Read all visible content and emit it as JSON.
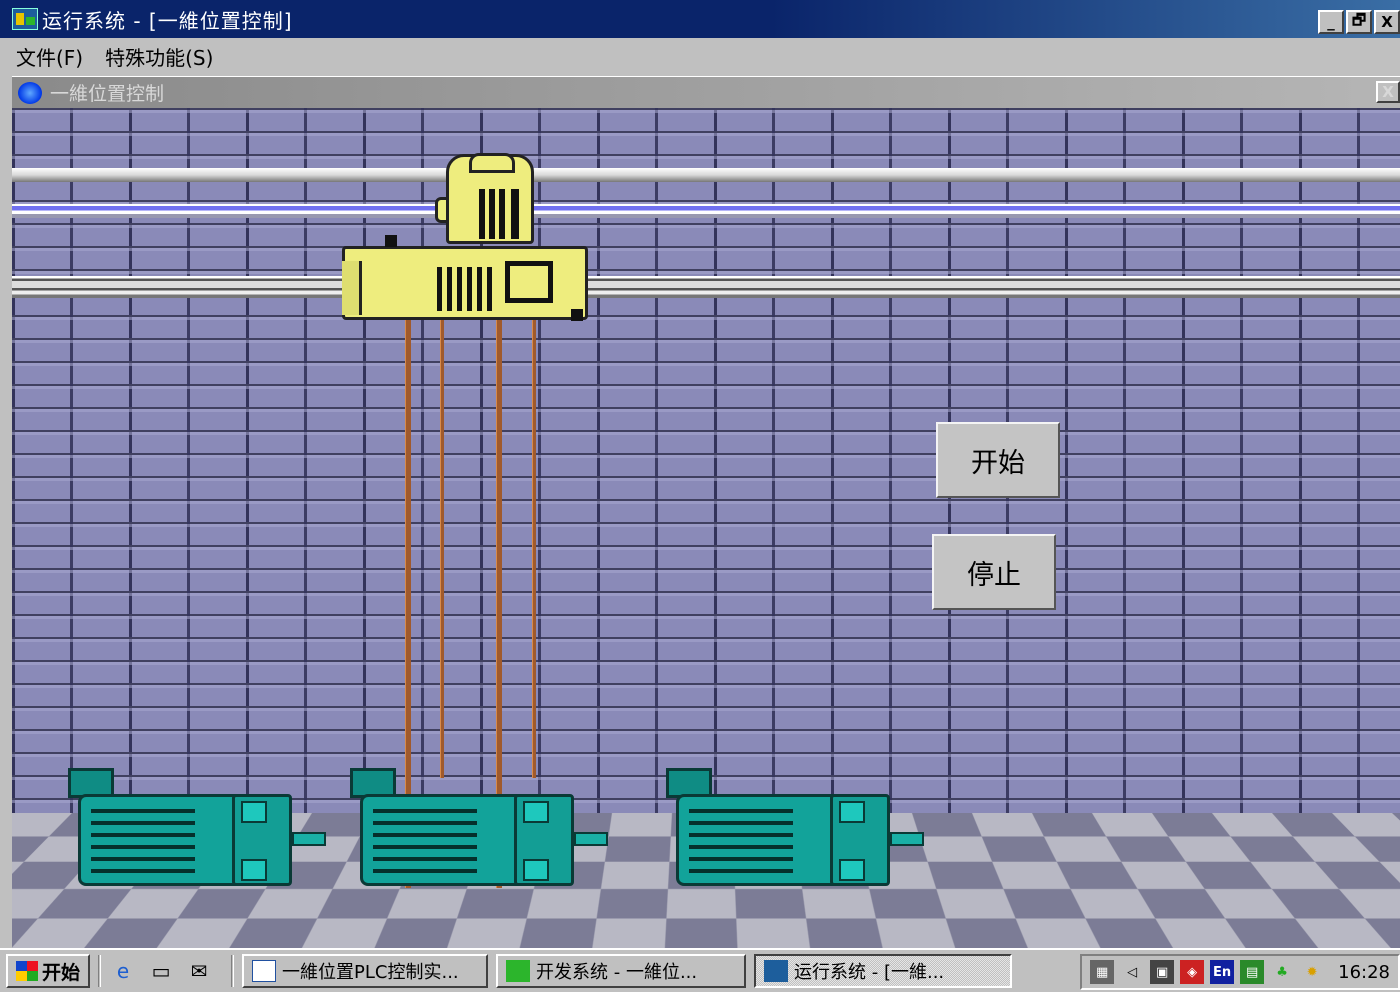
{
  "window": {
    "title": "运行系统 - [一維位置控制]",
    "buttons": {
      "minimize": "_",
      "restore": "🗗",
      "close": "X"
    }
  },
  "menu": {
    "items": [
      "文件(F)",
      "特殊功能(S)"
    ]
  },
  "inner_window": {
    "title": "一維位置控制",
    "close": "X"
  },
  "scene": {
    "start_button": "开始",
    "stop_button": "停止"
  },
  "taskbar": {
    "start_label": "开始",
    "tasks": [
      "一維位置PLC控制实...",
      "开发系统 - 一維位...",
      "运行系统 - [一維..."
    ],
    "active_task_index": 2,
    "tray": {
      "input_method": "En",
      "clock": "16:28"
    }
  }
}
